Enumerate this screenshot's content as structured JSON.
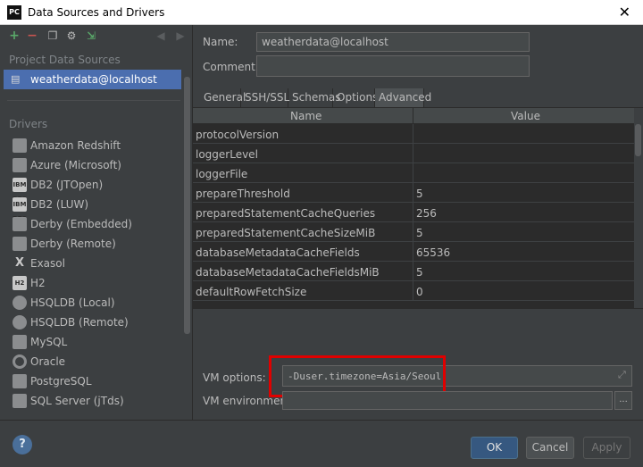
{
  "window": {
    "title": "Data Sources and Drivers",
    "app_icon": "PC"
  },
  "toolbar": {
    "icons": [
      "add-icon",
      "remove-icon",
      "copy-icon",
      "settings-icon",
      "import-icon",
      "back-icon",
      "forward-icon"
    ]
  },
  "sidebar": {
    "project_header": "Project Data Sources",
    "selected_source": "weatherdata@localhost",
    "drivers_header": "Drivers",
    "drivers": [
      {
        "label": "Amazon Redshift",
        "icon": ""
      },
      {
        "label": "Azure (Microsoft)",
        "icon": ""
      },
      {
        "label": "DB2 (JTOpen)",
        "icon": "IBM DB2"
      },
      {
        "label": "DB2 (LUW)",
        "icon": "IBM DB2"
      },
      {
        "label": "Derby (Embedded)",
        "icon": ""
      },
      {
        "label": "Derby (Remote)",
        "icon": ""
      },
      {
        "label": "Exasol",
        "icon": "X"
      },
      {
        "label": "H2",
        "icon": "H2"
      },
      {
        "label": "HSQLDB (Local)",
        "icon": ""
      },
      {
        "label": "HSQLDB (Remote)",
        "icon": ""
      },
      {
        "label": "MySQL",
        "icon": ""
      },
      {
        "label": "Oracle",
        "icon": ""
      },
      {
        "label": "PostgreSQL",
        "icon": ""
      },
      {
        "label": "SQL Server (jTds)",
        "icon": ""
      }
    ]
  },
  "form": {
    "name_label": "Name:",
    "name_value": "weatherdata@localhost",
    "comment_label": "Comment:",
    "comment_value": ""
  },
  "tabs": [
    "General",
    "SSH/SSL",
    "Schemas",
    "Options",
    "Advanced"
  ],
  "active_tab": "Advanced",
  "table": {
    "headers": [
      "Name",
      "Value"
    ],
    "rows": [
      {
        "name": "protocolVersion",
        "value": ""
      },
      {
        "name": "loggerLevel",
        "value": ""
      },
      {
        "name": "loggerFile",
        "value": ""
      },
      {
        "name": "prepareThreshold",
        "value": "5"
      },
      {
        "name": "preparedStatementCacheQueries",
        "value": "256"
      },
      {
        "name": "preparedStatementCacheSizeMiB",
        "value": "5"
      },
      {
        "name": "databaseMetadataCacheFields",
        "value": "65536"
      },
      {
        "name": "databaseMetadataCacheFieldsMiB",
        "value": "5"
      },
      {
        "name": "defaultRowFetchSize",
        "value": "0"
      }
    ]
  },
  "vm": {
    "options_label": "VM options:",
    "options_value": "-Duser.timezone=Asia/Seoul",
    "env_label": "VM environment:",
    "env_value": "",
    "dots": "..."
  },
  "buttons": {
    "help": "?",
    "ok": "OK",
    "cancel": "Cancel",
    "apply": "Apply"
  },
  "colors": {
    "accent": "#4b6eaf",
    "highlight": "#e00000",
    "ok_button": "#365880"
  }
}
